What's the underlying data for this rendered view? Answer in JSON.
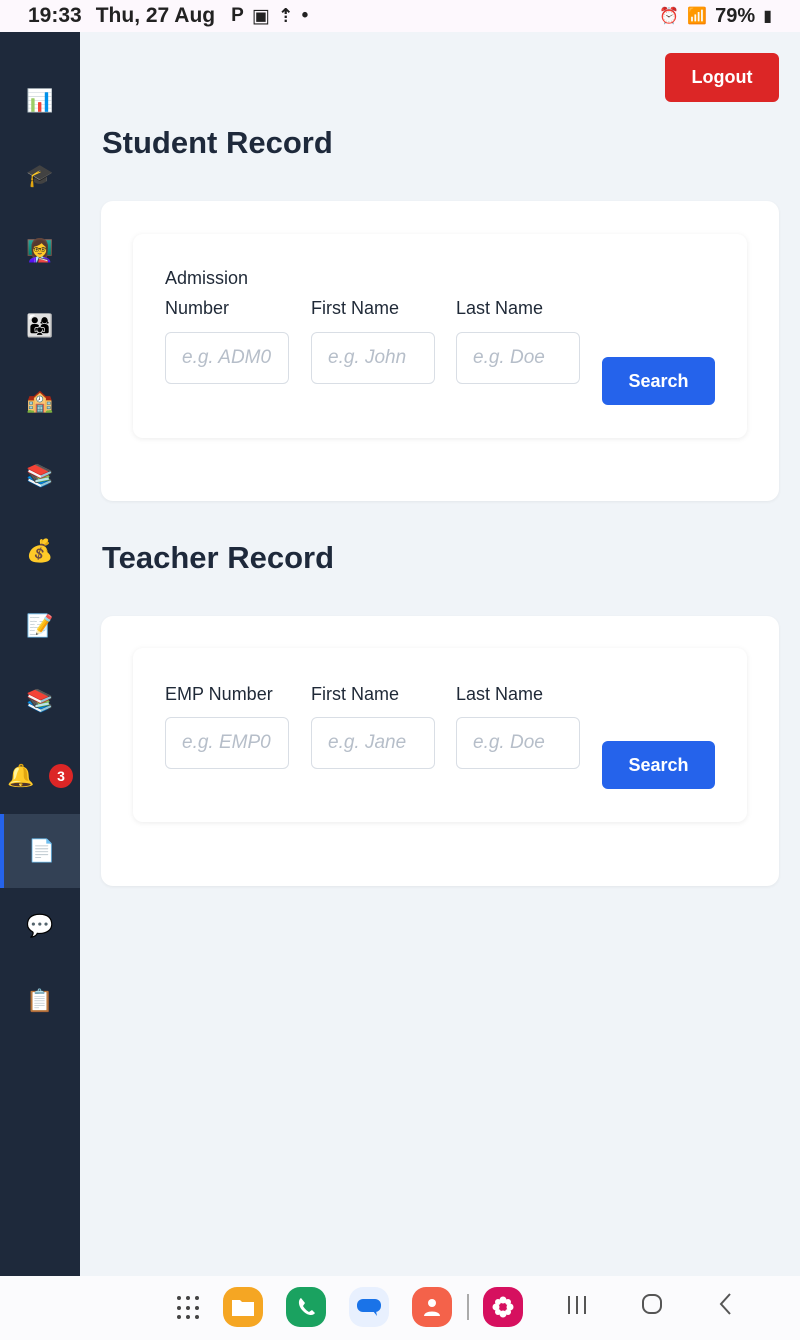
{
  "status_bar": {
    "time": "19:33",
    "date": "Thu, 27 Aug",
    "notification_icons": [
      "parking-icon",
      "image-icon",
      "upload-icon",
      "dot-icon"
    ],
    "battery": "79%"
  },
  "sidebar": {
    "items": [
      {
        "name": "dashboard",
        "icon": "📊"
      },
      {
        "name": "students",
        "icon": "🎓"
      },
      {
        "name": "teachers",
        "icon": "👩‍🏫"
      },
      {
        "name": "parents",
        "icon": "👨‍👩‍👧"
      },
      {
        "name": "school",
        "icon": "🏫"
      },
      {
        "name": "classes",
        "icon": "📚"
      },
      {
        "name": "finance",
        "icon": "💰"
      },
      {
        "name": "exams",
        "icon": "📝"
      },
      {
        "name": "library",
        "icon": "📚"
      },
      {
        "name": "notifications",
        "icon": "🔔",
        "badge": "3"
      },
      {
        "name": "records",
        "icon": "📄",
        "active": true
      },
      {
        "name": "messages",
        "icon": "💬"
      },
      {
        "name": "reports",
        "icon": "📋"
      }
    ]
  },
  "header": {
    "logout_label": "Logout"
  },
  "student_record": {
    "title": "Student Record",
    "fields": [
      {
        "label": "Admission Number",
        "placeholder": "e.g. ADM0"
      },
      {
        "label": "First Name",
        "placeholder": "e.g. John"
      },
      {
        "label": "Last Name",
        "placeholder": "e.g. Doe"
      }
    ],
    "search_label": "Search"
  },
  "teacher_record": {
    "title": "Teacher Record",
    "fields": [
      {
        "label": "EMP Number",
        "placeholder": "e.g. EMP0"
      },
      {
        "label": "First Name",
        "placeholder": "e.g. Jane"
      },
      {
        "label": "Last Name",
        "placeholder": "e.g. Doe"
      }
    ],
    "search_label": "Search"
  },
  "nav_bar": {
    "apps": [
      "apps-grid-icon",
      "files-icon",
      "phone-icon",
      "messages-icon",
      "contacts-icon",
      "gallery-icon"
    ],
    "system": [
      "recents-icon",
      "home-icon",
      "back-icon"
    ]
  }
}
